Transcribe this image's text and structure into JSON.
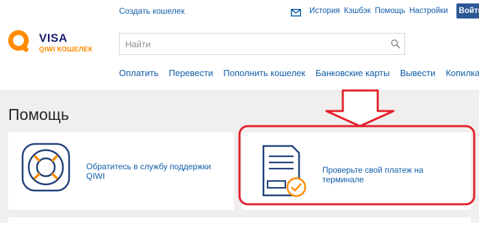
{
  "header": {
    "create_wallet": "Создать кошелек",
    "top_nav": [
      "История",
      "Кэшбэк",
      "Помощь",
      "Настройки"
    ],
    "login_label": "Войти",
    "logo": {
      "line1": "VISA",
      "line2": "QIWI КОШЕЛЕК"
    },
    "search": {
      "placeholder": "Найти"
    },
    "main_nav": [
      "Оплатить",
      "Перевести",
      "Пополнить кошелек",
      "Банковские карты",
      "Вывести",
      "Копилка"
    ]
  },
  "main": {
    "title": "Помощь",
    "cards": [
      {
        "text": "Обратитесь в службу поддержки QIWI",
        "icon": "lifebuoy-icon"
      },
      {
        "text": "Проверьте свой платеж на терминале",
        "icon": "receipt-check-icon"
      }
    ]
  },
  "annotation": {
    "color": "#e3202a"
  },
  "colors": {
    "accent": "#0e5ca8",
    "brand_orange": "#ff8c00",
    "login_bg": "#2b5797",
    "content_bg": "#f0efed",
    "visa_navy": "#1a1f71"
  }
}
